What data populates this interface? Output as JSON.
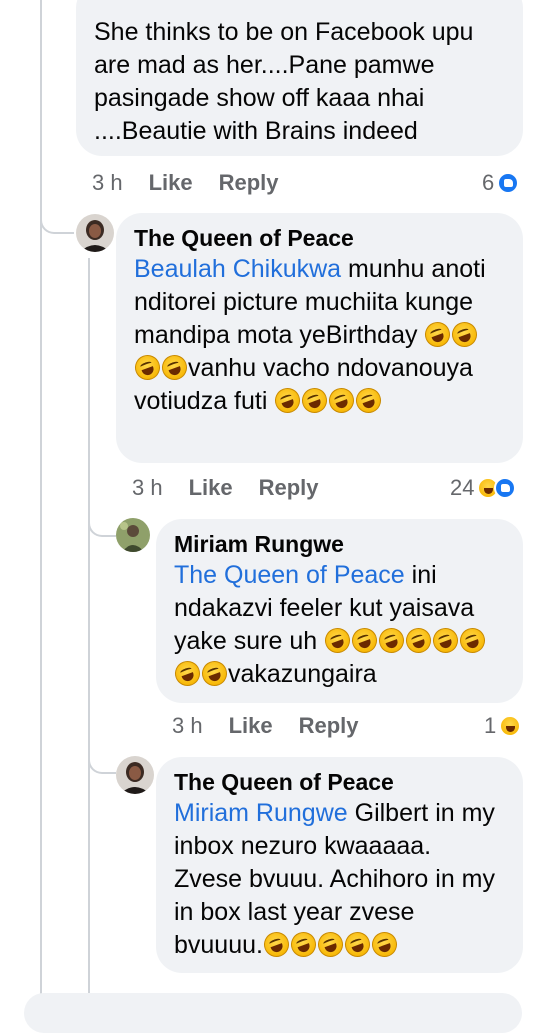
{
  "comments": [
    {
      "text": "She thinks to be on Facebook upu are mad as her....Pane pamwe pasingade show off kaaa nhai ....Beautie with Brains indeed",
      "time": "3 h",
      "like": "Like",
      "reply": "Reply",
      "reactions": "6"
    },
    {
      "author": "The Queen of Peace",
      "mention": "Beaulah Chikukwa",
      "text_a": " munhu anoti nditorei picture muchiita kunge mandipa mota yeBirthday ",
      "text_b": "vanhu vacho ndovanouya votiudza futi ",
      "time": "3 h",
      "like": "Like",
      "reply": "Reply",
      "reactions": "24"
    },
    {
      "author": "Miriam Rungwe",
      "mention": "The Queen of Peace",
      "text_a": " ini ndakazvi feeler kut yaisava yake sure uh ",
      "text_b": "vakazungaira",
      "time": "3 h",
      "like": "Like",
      "reply": "Reply",
      "reactions": "1"
    },
    {
      "author": "The Queen of Peace",
      "mention": "Miriam Rungwe",
      "text_a": " Gilbert in my inbox nezuro kwaaaaa. Zvese bvuuu. Achihoro in my in box last year zvese bvuuuu."
    }
  ],
  "colors": {
    "bubble": "#f0f2f5",
    "mention": "#216fdb",
    "meta": "#65676b",
    "like_blue": "#1877f2"
  },
  "icons": {
    "laugh_emoji": "rolling-on-floor-laughing-icon",
    "like_reaction": "like-reaction-icon",
    "haha_reaction": "haha-reaction-icon"
  }
}
